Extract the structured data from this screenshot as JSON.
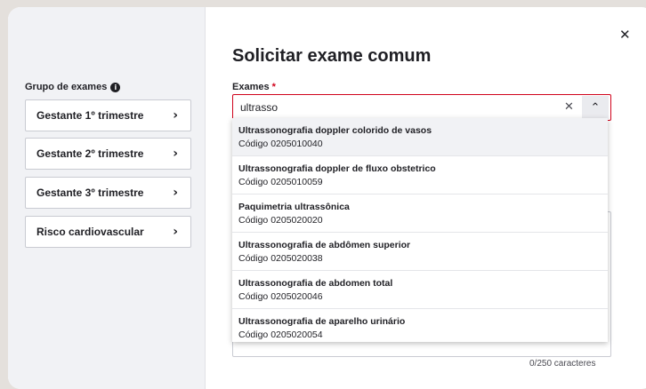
{
  "sidebar": {
    "title": "Grupo de exames",
    "info_icon": "i",
    "items": [
      {
        "label": "Gestante 1º trimestre"
      },
      {
        "label": "Gestante 2º trimestre"
      },
      {
        "label": "Gestante 3º trimestre"
      },
      {
        "label": "Risco cardiovascular"
      }
    ],
    "chevron": "›"
  },
  "modal": {
    "close_icon": "✕",
    "title": "Solicitar exame comum"
  },
  "exams_field": {
    "label": "Exames",
    "required_mark": "*",
    "value": "ultrasso",
    "clear_icon": "✕",
    "toggle_icon": "⌃"
  },
  "options": [
    {
      "name": "Ultrassonografia doppler colorido de vasos",
      "code": "Código 0205010040"
    },
    {
      "name": "Ultrassonografia doppler de fluxo obstetrico",
      "code": "Código 0205010059"
    },
    {
      "name": "Paquimetria ultrassônica",
      "code": "Código 0205020020"
    },
    {
      "name": "Ultrassonografia de abdômen superior",
      "code": "Código 0205020038"
    },
    {
      "name": "Ultrassonografia de abdomen total",
      "code": "Código 0205020046"
    },
    {
      "name": "Ultrassonografia de aparelho urinário",
      "code": "Código 0205020054"
    }
  ],
  "notes": {
    "counter": "0/250 caracteres"
  },
  "colors": {
    "required": "#d0021b",
    "sidebar_bg": "#f1f2f5",
    "backdrop": "#e4e0dc"
  }
}
